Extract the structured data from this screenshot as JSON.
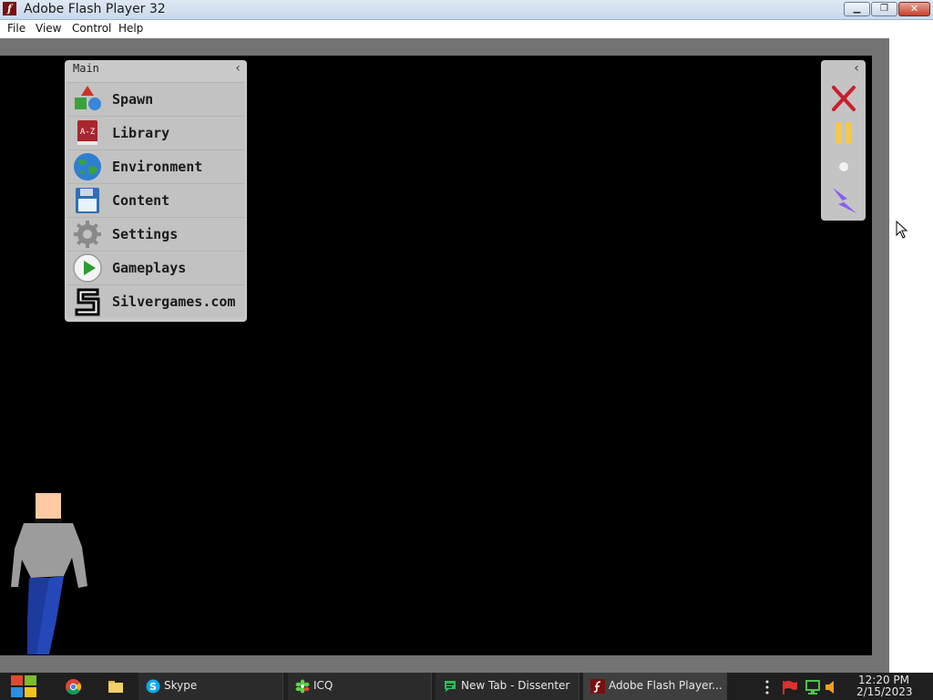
{
  "window": {
    "title": "Adobe Flash Player 32",
    "app_icon_letter": "f",
    "minimize_glyph": "▁",
    "maximize_glyph": "❐",
    "close_glyph": "✕"
  },
  "menubar": {
    "items": [
      "File",
      "View",
      "Control",
      "Help"
    ]
  },
  "main_panel": {
    "title": "Main",
    "collapse_glyph": "‹",
    "items": [
      {
        "label": "Spawn",
        "icon": "shapes-icon"
      },
      {
        "label": "Library",
        "icon": "library-book-icon",
        "icon_text": "A-Z"
      },
      {
        "label": "Environment",
        "icon": "globe-icon"
      },
      {
        "label": "Content",
        "icon": "floppy-disk-icon"
      },
      {
        "label": "Settings",
        "icon": "gear-icon"
      },
      {
        "label": "Gameplays",
        "icon": "play-icon"
      },
      {
        "label": "Silvergames.com",
        "icon": "silvergames-logo-icon"
      }
    ]
  },
  "tool_panel": {
    "collapse_glyph": "‹",
    "tools": [
      {
        "name": "delete-tool",
        "icon": "red-x-icon",
        "color": "#c8202a"
      },
      {
        "name": "pause-tool",
        "icon": "pause-icon",
        "color": "#f2c94c"
      },
      {
        "name": "point-tool",
        "icon": "dot-icon",
        "color": "#f2f2f2"
      },
      {
        "name": "lightning-tool",
        "icon": "lightning-icon",
        "color": "#8a5cf5"
      }
    ]
  },
  "taskbar": {
    "buttons": [
      {
        "label": "Skype",
        "icon": "skype-icon"
      },
      {
        "label": "ICQ",
        "icon": "icq-icon"
      },
      {
        "label": "New Tab - Dissenter",
        "icon": "dissenter-icon"
      },
      {
        "label": "Adobe Flash Player...",
        "icon": "flash-icon"
      }
    ],
    "clock_time": "12:20 PM",
    "clock_date": "2/15/2023"
  },
  "colors": {
    "stage_bg": "#000000",
    "stage_frame": "#737373",
    "panel_bg": "#c9c9c9",
    "taskbar_bg": "#1f1f1f"
  }
}
